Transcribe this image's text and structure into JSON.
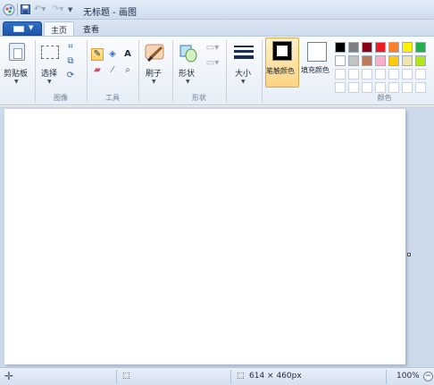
{
  "window": {
    "title": "无标题 - 画图"
  },
  "quick_access": {
    "save_icon": "save-icon",
    "undo_icon": "undo-icon",
    "redo_icon": "redo-icon",
    "customize_icon": "chevron-down-icon"
  },
  "tabs": {
    "file_icon": "paint-menu-icon",
    "home": "主页",
    "view": "查看"
  },
  "ribbon": {
    "clipboard": {
      "button": "剪贴板",
      "group": ""
    },
    "image": {
      "select": "选择",
      "group": "图像"
    },
    "tools": {
      "group": "工具"
    },
    "brushes": {
      "button": "刷子"
    },
    "shapes": {
      "button": "形状",
      "group": "形状"
    },
    "size": {
      "button": "大小"
    },
    "color1": {
      "button": "笔触颜色"
    },
    "color2": {
      "button": "填充颜色"
    },
    "colors": {
      "group": "颜色",
      "row1": [
        "#000000",
        "#7f7f7f",
        "#880015",
        "#ed1c24",
        "#ff7f27",
        "#fff200",
        "#22b14c"
      ],
      "row2": [
        "#ffffff",
        "#c3c3c3",
        "#b97a57",
        "#ffaec9",
        "#ffc90e",
        "#efe4b0",
        "#b5e61d"
      ],
      "row3": [
        "#ffffff",
        "#ffffff",
        "#ffffff",
        "#ffffff",
        "#ffffff",
        "#ffffff",
        "#ffffff"
      ],
      "row4": [
        "#ffffff",
        "#ffffff",
        "#ffffff",
        "#ffffff",
        "#ffffff",
        "#ffffff",
        "#ffffff"
      ]
    }
  },
  "status": {
    "dimensions": "614 × 460px",
    "zoom": "100%",
    "zoom_out": "−"
  }
}
